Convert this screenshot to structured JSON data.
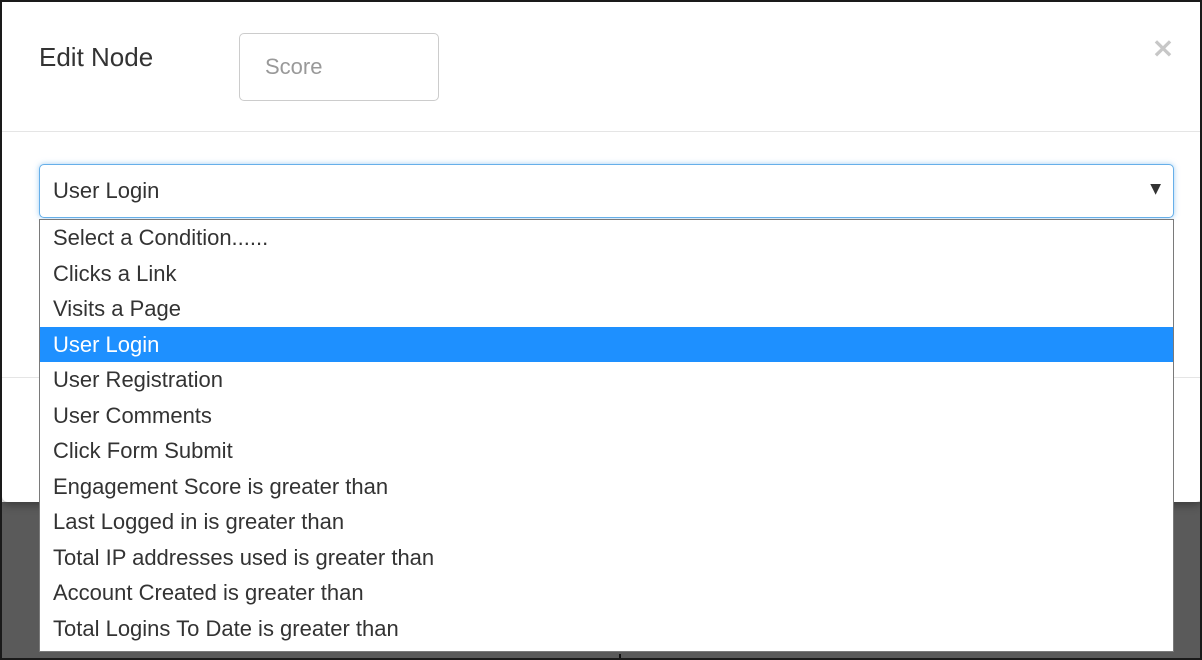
{
  "modal": {
    "title": "Edit Node",
    "score_placeholder": "Score",
    "close_icon": "×"
  },
  "condition_select": {
    "value": "User Login",
    "arrow_icon": "▼",
    "options": [
      "Select a Condition......",
      "Clicks a Link",
      "Visits a Page",
      "User Login",
      "User Registration",
      "User Comments",
      "Click Form Submit",
      "Engagement Score is greater than",
      "Last Logged in is greater than",
      "Total IP addresses used is greater than",
      "Account Created is greater than",
      "Total Logins To Date is greater than"
    ],
    "selected_index": 3
  },
  "colors": {
    "highlight": "#1e90ff",
    "focus_border": "#66afe9",
    "backdrop": "#5a5a5a"
  }
}
